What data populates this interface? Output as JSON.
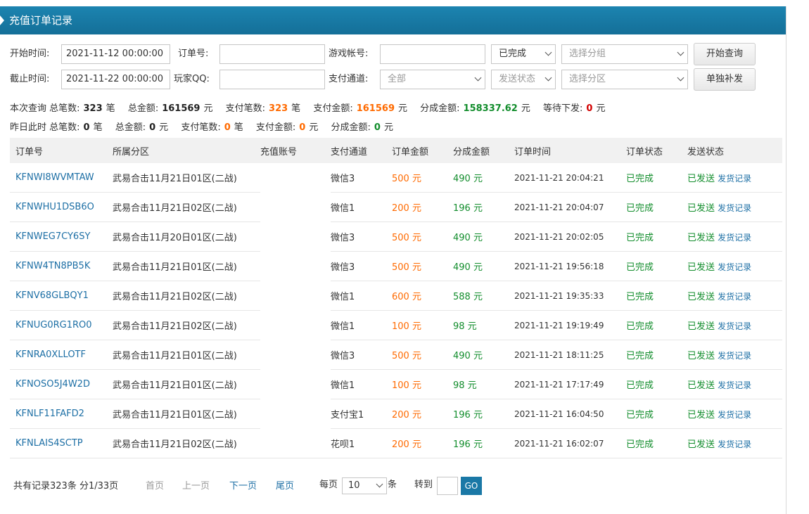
{
  "title": "充值订单记录",
  "filters": {
    "start_label": "开始时间:",
    "start_value": "2021-11-12 00:00:00",
    "end_label": "截止时间:",
    "end_value": "2021-11-22 00:00:00",
    "order_label": "订单号:",
    "qq_label": "玩家QQ:",
    "account_label": "游戏帐号:",
    "channel_label": "支付通道:",
    "status_select": "已完成",
    "group_select": "选择分组",
    "channel_select": "全部",
    "send_status_select": "发送状态",
    "zone_select": "选择分区",
    "query_button": "开始查询",
    "resend_button": "单独补发"
  },
  "stats": {
    "current": {
      "prefix": "本次查询 总笔数:",
      "total_count": "323",
      "unit1": "笔",
      "amount_label": "总金额:",
      "amount": "161569",
      "unit2": "元",
      "paid_count_label": "支付笔数:",
      "paid_count": "323",
      "unit3": "笔",
      "paid_amount_label": "支付金额:",
      "paid_amount": "161569",
      "unit4": "元",
      "share_label": "分成金额:",
      "share": "158337.62",
      "unit5": "元",
      "pending_label": "等待下发:",
      "pending": "0",
      "unit6": "元"
    },
    "yesterday": {
      "prefix": "昨日此时 总笔数:",
      "total_count": "0",
      "unit1": "笔",
      "amount_label": "总金额:",
      "amount": "0",
      "unit2": "元",
      "paid_count_label": "支付笔数:",
      "paid_count": "0",
      "unit3": "笔",
      "paid_amount_label": "支付金额:",
      "paid_amount": "0",
      "unit4": "元",
      "share_label": "分成金额:",
      "share": "0",
      "unit5": "元"
    }
  },
  "table": {
    "headers": [
      "订单号",
      "所属分区",
      "充值账号",
      "支付通道",
      "订单金额",
      "分成金额",
      "订单时间",
      "订单状态",
      "发送状态"
    ],
    "send_link": "发货记录",
    "rows": [
      {
        "order": "KFNWI8WVMTAW",
        "zone": "武易合击11月21日01区(二战)",
        "account": "",
        "channel": "微信3",
        "amount": "500 元",
        "share": "490 元",
        "time": "2021-11-21 20:04:21",
        "status": "已完成",
        "sent": "已发送"
      },
      {
        "order": "KFNWHU1DSB6O",
        "zone": "武易合击11月21日02区(二战)",
        "account": "",
        "channel": "微信1",
        "amount": "200 元",
        "share": "196 元",
        "time": "2021-11-21 20:04:07",
        "status": "已完成",
        "sent": "已发送"
      },
      {
        "order": "KFNWEG7CY6SY",
        "zone": "武易合击11月20日01区(二战)",
        "account": "",
        "channel": "微信3",
        "amount": "500 元",
        "share": "490 元",
        "time": "2021-11-21 20:02:05",
        "status": "已完成",
        "sent": "已发送"
      },
      {
        "order": "KFNW4TN8PB5K",
        "zone": "武易合击11月21日01区(二战)",
        "account": "",
        "channel": "微信3",
        "amount": "500 元",
        "share": "490 元",
        "time": "2021-11-21 19:56:18",
        "status": "已完成",
        "sent": "已发送"
      },
      {
        "order": "KFNV68GLBQY1",
        "zone": "武易合击11月21日02区(二战)",
        "account": "",
        "channel": "微信1",
        "amount": "600 元",
        "share": "588 元",
        "time": "2021-11-21 19:35:33",
        "status": "已完成",
        "sent": "已发送"
      },
      {
        "order": "KFNUG0RG1RO0",
        "zone": "武易合击11月21日02区(二战)",
        "account": "",
        "channel": "微信1",
        "amount": "100 元",
        "share": "98 元",
        "time": "2021-11-21 19:19:49",
        "status": "已完成",
        "sent": "已发送"
      },
      {
        "order": "KFNRA0XLLOTF",
        "zone": "武易合击11月21日01区(二战)",
        "account": "",
        "channel": "微信3",
        "amount": "500 元",
        "share": "490 元",
        "time": "2021-11-21 18:11:25",
        "status": "已完成",
        "sent": "已发送"
      },
      {
        "order": "KFNOSO5J4W2D",
        "zone": "武易合击11月21日01区(二战)",
        "account": "",
        "channel": "微信1",
        "amount": "100 元",
        "share": "98 元",
        "time": "2021-11-21 17:17:49",
        "status": "已完成",
        "sent": "已发送"
      },
      {
        "order": "KFNLF11FAFD2",
        "zone": "武易合击11月21日01区(二战)",
        "account": "",
        "channel": "支付宝1",
        "amount": "200 元",
        "share": "196 元",
        "time": "2021-11-21 16:04:50",
        "status": "已完成",
        "sent": "已发送"
      },
      {
        "order": "KFNLAIS4SCTP",
        "zone": "武易合击11月21日02区(二战)",
        "account": "",
        "channel": "花呗1",
        "amount": "200 元",
        "share": "196 元",
        "time": "2021-11-21 16:02:07",
        "status": "已完成",
        "sent": "已发送"
      }
    ]
  },
  "pager": {
    "summary": "共有记录323条 分1/33页",
    "first": "首页",
    "prev": "上一页",
    "next": "下一页",
    "last": "尾页",
    "per_page_label": "每页",
    "per_page_value": "10",
    "per_page_unit": "条",
    "goto_label": "转到",
    "go_button": "GO"
  }
}
